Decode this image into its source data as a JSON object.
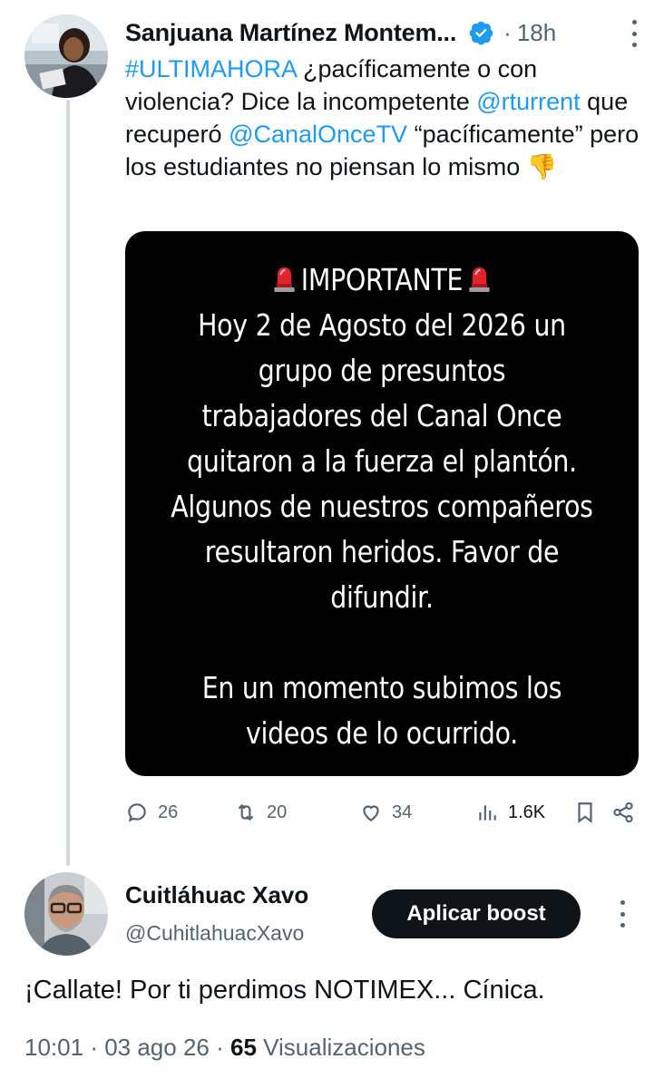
{
  "tweet": {
    "author_name": "Sanjuana Martínez Montem...",
    "time_ago": "18h",
    "text_parts": {
      "hashtag": "#ULTIMAHORA",
      "p1": " ¿pacíficamente o con violencia? Dice la incompetente ",
      "mention1": "@rturrent",
      "p2": " que recuperó ",
      "mention2": "@CanalOnceTV",
      "p3": " “pacíficamente” pero los estudiantes no piensan lo mismo 👎"
    },
    "media_text": {
      "heading": "IMPORTANTE",
      "lines": [
        "Hoy 2 de Agosto del 2026 un",
        "grupo de presuntos",
        "trabajadores del Canal Once",
        "quitaron a la fuerza el plantón.",
        "Algunos de nuestros compañeros",
        "resultaron heridos. Favor de",
        "difundir.",
        "En un momento subimos los",
        "videos de lo ocurrido."
      ]
    },
    "stats": {
      "replies": "26",
      "retweets": "20",
      "likes": "34",
      "views": "1.6K"
    }
  },
  "reply": {
    "author_name": "Cuitláhuac Xavo",
    "handle": "@CuhitlahuacXavo",
    "boost_label": "Aplicar boost",
    "text": "¡Callate! Por ti perdimos NOTIMEX... Cínica.",
    "time": "10:01",
    "date": "03 ago 26",
    "views_count": "65",
    "views_label": "Visualizaciones"
  },
  "colors": {
    "link": "#1d9bf0",
    "muted": "#536471",
    "text": "#0f1419",
    "verified": "#1d9bf0"
  }
}
